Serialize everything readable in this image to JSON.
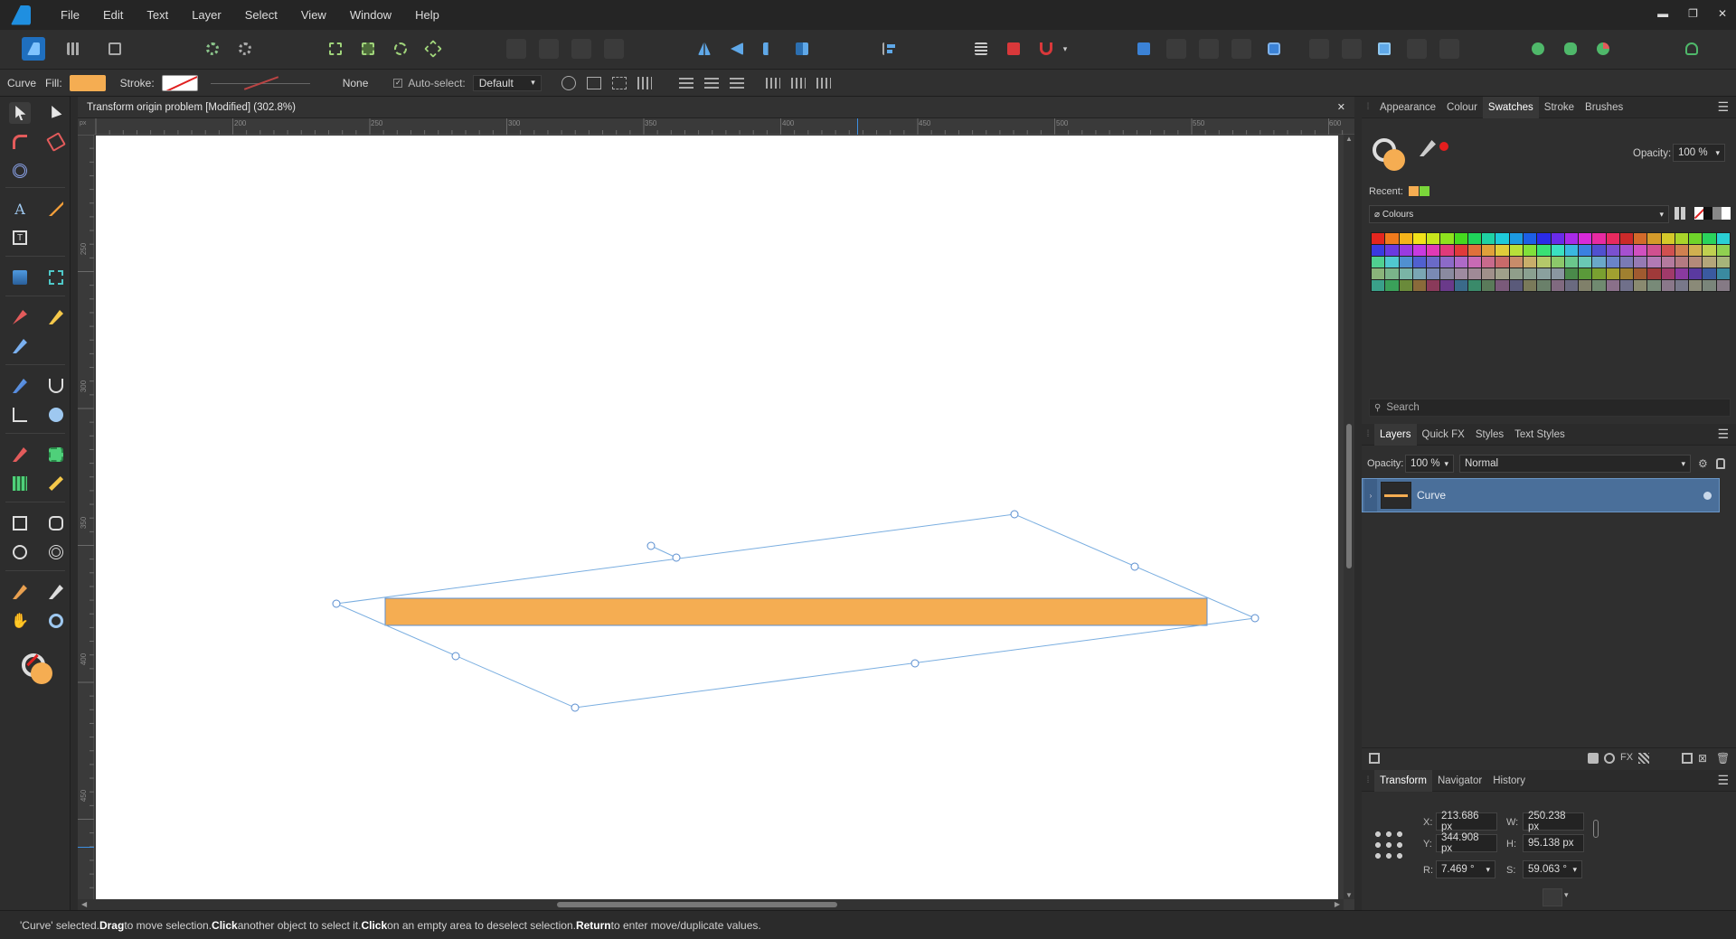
{
  "menubar": {
    "items": [
      "File",
      "Edit",
      "Text",
      "Layer",
      "Select",
      "View",
      "Window",
      "Help"
    ],
    "window_controls": {
      "minimize": "▬",
      "restore": "❐",
      "close": "✕"
    }
  },
  "context": {
    "object_type": "Curve",
    "fill_label": "Fill:",
    "fill_color": "#f5ad52",
    "stroke_label": "Stroke:",
    "stroke_value": "None",
    "autoselect_label": "Auto-select:",
    "autoselect_value": "Default"
  },
  "document": {
    "title": "Transform origin problem [Modified] (302.8%)",
    "close": "✕",
    "ruler_unit": "px",
    "h_ticks": [
      "200",
      "250",
      "300",
      "350",
      "400",
      "450",
      "500",
      "550",
      "600"
    ],
    "v_ticks": [
      "250",
      "300",
      "350",
      "400",
      "450"
    ],
    "shape_fill": "#f5ad52"
  },
  "swatches_panel": {
    "tabs": [
      "Appearance",
      "Colour",
      "Swatches",
      "Stroke",
      "Brushes"
    ],
    "active_tab": "Swatches",
    "opacity_label": "Opacity:",
    "opacity_value": "100 %",
    "recent_label": "Recent:",
    "recent_colors": [
      "#f5ad52",
      "#7ad63a"
    ],
    "palette_name": "Colours",
    "search_placeholder": "Search",
    "palette_colors": [
      "#e3261f",
      "#f07a1c",
      "#f5b31a",
      "#f2e21a",
      "#c8e61c",
      "#8ee21e",
      "#45d91f",
      "#1fd45a",
      "#1fd2a3",
      "#1ecad9",
      "#1c9ae2",
      "#1c5fe6",
      "#2a2be8",
      "#6a2be9",
      "#a92ae8",
      "#d82ad9",
      "#e82aa2",
      "#e82a5f",
      "#cc2a2a",
      "#d46a2a",
      "#d49a2a",
      "#d4c82a",
      "#a9d42a",
      "#6fd42a",
      "#2ad45c",
      "#2acfd4",
      "#3a3ae0",
      "#6a3ae0",
      "#9a3ae0",
      "#c83ae0",
      "#e03ab5",
      "#e03a7a",
      "#e03a3a",
      "#e0703a",
      "#e0a03a",
      "#e0cc3a",
      "#b8e03a",
      "#80e03a",
      "#3ae074",
      "#3ae0c0",
      "#3ab8e0",
      "#3a80e0",
      "#5050d0",
      "#7a50d0",
      "#a550d0",
      "#d050c0",
      "#d05090",
      "#d05050",
      "#d08050",
      "#d0b050",
      "#c0d050",
      "#90d050",
      "#50d090",
      "#50c8d0",
      "#5090d0",
      "#5060d0",
      "#6a6ac8",
      "#8c6ac8",
      "#ae6ac8",
      "#c86ab4",
      "#c86a8c",
      "#c86a6a",
      "#c88c6a",
      "#c8ae6a",
      "#b4c86a",
      "#8cc86a",
      "#6ac88c",
      "#6ac8b4",
      "#6aa8c8",
      "#6a84c8",
      "#7a7ab4",
      "#967ab4",
      "#b27ab4",
      "#b47a9e",
      "#b47a82",
      "#b48a7a",
      "#b4a67a",
      "#a6b47a",
      "#8ab47a",
      "#7ab48a",
      "#7ab4a6",
      "#7aa6b4",
      "#7a8ab4",
      "#8a8aa0",
      "#9e8aa0",
      "#a08a96",
      "#a0908a",
      "#a0a08a",
      "#909e8a",
      "#8aa090",
      "#8aa09e",
      "#8a96a0",
      "#4a8a4a",
      "#5a9a3a",
      "#7aa030",
      "#a0a030",
      "#a08030",
      "#a05a30",
      "#a03a3a",
      "#a03a6a",
      "#8a3aa0",
      "#5a3aa0",
      "#3a5aa0",
      "#3a8aa0",
      "#3aa08a",
      "#3aa05a",
      "#6a8a3a",
      "#8a6a3a",
      "#8a3a5a",
      "#6a3a8a",
      "#3a6a8a",
      "#3a8a6a",
      "#5a7a5a",
      "#7a5a7a",
      "#5a5a7a",
      "#7a7a5a",
      "#6a806a",
      "#806a80",
      "#6a6a80",
      "#80806a",
      "#708a70",
      "#8a708a",
      "#70708a",
      "#8a8a70",
      "#788a78",
      "#8a788a",
      "#78788a",
      "#8a8a78",
      "#7a857a",
      "#857a85"
    ]
  },
  "layers_panel": {
    "tabs": [
      "Layers",
      "Quick FX",
      "Styles",
      "Text Styles"
    ],
    "active_tab": "Layers",
    "opacity_label": "Opacity:",
    "opacity_value": "100 %",
    "blend_mode": "Normal",
    "layers": [
      {
        "name": "Curve",
        "selected": true
      }
    ]
  },
  "transform_panel": {
    "tabs": [
      "Transform",
      "Navigator",
      "History"
    ],
    "active_tab": "Transform",
    "x_label": "X:",
    "x_value": "213.686 px",
    "y_label": "Y:",
    "y_value": "344.908 px",
    "w_label": "W:",
    "w_value": "250.238 px",
    "h_label": "H:",
    "h_value": "95.138 px",
    "r_label": "R:",
    "r_value": "7.469 °",
    "s_label": "S:",
    "s_value": "59.063 °"
  },
  "statusbar": {
    "p1": "'Curve' selected. ",
    "b1": "Drag",
    "p2": " to move selection. ",
    "b2": "Click",
    "p3": " another object to select it. ",
    "b3": "Click",
    "p4": " on an empty area to deselect selection. ",
    "b4": "Return",
    "p5": " to enter move/duplicate values."
  }
}
